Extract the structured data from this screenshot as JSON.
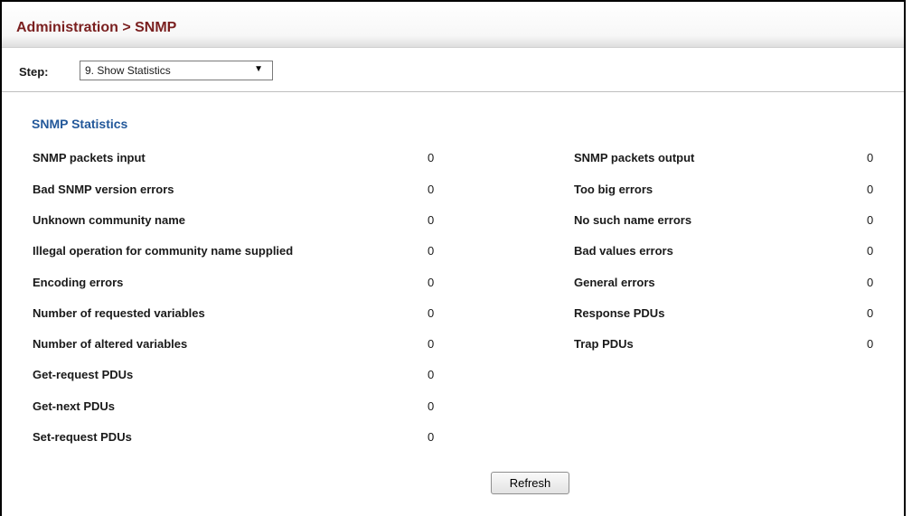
{
  "header": {
    "title": "Administration > SNMP"
  },
  "step": {
    "label": "Step:",
    "selected": "9. Show Statistics",
    "arrow": "▼"
  },
  "section": {
    "title": "SNMP Statistics"
  },
  "stats_left": [
    {
      "label": "SNMP packets input",
      "value": "0"
    },
    {
      "label": "Bad SNMP version errors",
      "value": "0"
    },
    {
      "label": "Unknown community name",
      "value": "0"
    },
    {
      "label": "Illegal operation for community name supplied",
      "value": "0"
    },
    {
      "label": "Encoding errors",
      "value": "0"
    },
    {
      "label": "Number of requested variables",
      "value": "0"
    },
    {
      "label": "Number of altered variables",
      "value": "0"
    },
    {
      "label": "Get-request PDUs",
      "value": "0"
    },
    {
      "label": "Get-next PDUs",
      "value": "0"
    },
    {
      "label": "Set-request PDUs",
      "value": "0"
    }
  ],
  "stats_right": [
    {
      "label": "SNMP packets output",
      "value": "0"
    },
    {
      "label": "Too big errors",
      "value": "0"
    },
    {
      "label": "No such name errors",
      "value": "0"
    },
    {
      "label": "Bad values errors",
      "value": "0"
    },
    {
      "label": "General errors",
      "value": "0"
    },
    {
      "label": "Response PDUs",
      "value": "0"
    },
    {
      "label": "Trap PDUs",
      "value": "0"
    }
  ],
  "actions": {
    "refresh_label": "Refresh"
  },
  "colors": {
    "title": "#7a1f1f",
    "section_title": "#23589a"
  }
}
